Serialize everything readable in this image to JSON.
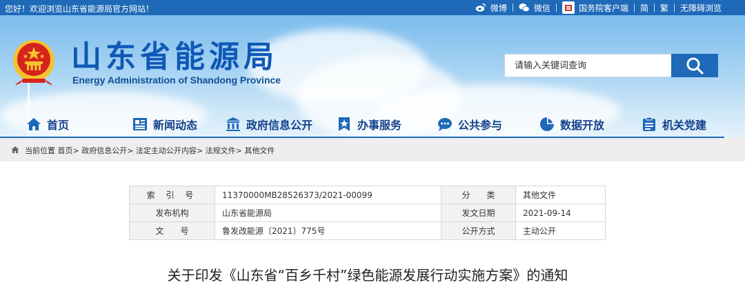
{
  "topbar": {
    "welcome": "您好！欢迎浏览山东省能源局官方网站！",
    "links": [
      "微博",
      "微信",
      "国务院客户端",
      "简",
      "繁",
      "无障碍浏览"
    ]
  },
  "header": {
    "title": "山东省能源局",
    "subtitle": "Energy Administration of Shandong Province",
    "search_placeholder": "请输入关键词查询"
  },
  "nav": {
    "items": [
      "首页",
      "新闻动态",
      "政府信息公开",
      "办事服务",
      "公共参与",
      "数据开放",
      "机关党建"
    ]
  },
  "breadcrumb": {
    "label": "当前位置",
    "path": "首页> 政府信息公开> 法定主动公开内容> 法规文件> 其他文件"
  },
  "info": {
    "rows": [
      {
        "l1": "索 引 号",
        "v1": "11370000MB28526373/2021-00099",
        "l2": "分　　类",
        "v2": "其他文件"
      },
      {
        "l1": "发布机构",
        "v1": "山东省能源局",
        "l2": "发文日期",
        "v2": "2021-09-14"
      },
      {
        "l1": "文　　号",
        "v1": "鲁发改能源〔2021〕775号",
        "l2": "公开方式",
        "v2": "主动公开"
      }
    ]
  },
  "article": {
    "title": "关于印发《山东省“百乡千村”绿色能源发展行动实施方案》的通知"
  },
  "colors": {
    "brand_blue": "#1e69b8",
    "title_blue": "#0f58b6",
    "emblem_red": "#d8231c",
    "emblem_gold": "#f3c32f"
  }
}
